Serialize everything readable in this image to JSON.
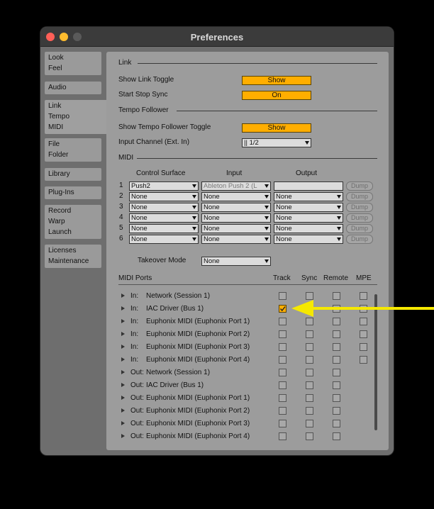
{
  "window": {
    "title": "Preferences"
  },
  "sidebar": {
    "tabs": [
      {
        "lines": [
          "Look",
          "Feel"
        ]
      },
      {
        "lines": [
          "Audio"
        ]
      },
      {
        "lines": [
          "Link",
          "Tempo",
          "MIDI"
        ]
      },
      {
        "lines": [
          "File",
          "Folder"
        ]
      },
      {
        "lines": [
          "Library"
        ]
      },
      {
        "lines": [
          "Plug-Ins"
        ]
      },
      {
        "lines": [
          "Record",
          "Warp",
          "Launch"
        ]
      },
      {
        "lines": [
          "Licenses",
          "Maintenance"
        ]
      }
    ]
  },
  "link": {
    "heading": "Link",
    "show_link_toggle_label": "Show Link Toggle",
    "show_link_toggle_value": "Show",
    "start_stop_sync_label": "Start Stop Sync",
    "start_stop_sync_value": "On"
  },
  "tempo": {
    "heading": "Tempo Follower",
    "show_toggle_label": "Show Tempo Follower Toggle",
    "show_toggle_value": "Show",
    "input_channel_label": "Input Channel (Ext. In)",
    "input_channel_value": "|| 1/2"
  },
  "midi": {
    "heading": "MIDI",
    "col_surface": "Control Surface",
    "col_input": "Input",
    "col_output": "Output",
    "rows": [
      {
        "num": "1",
        "surface": "Push2",
        "input": "Ableton Push 2 (L",
        "output": "",
        "dump": "Dump"
      },
      {
        "num": "2",
        "surface": "None",
        "input": "None",
        "output": "None",
        "dump": "Dump"
      },
      {
        "num": "3",
        "surface": "None",
        "input": "None",
        "output": "None",
        "dump": "Dump"
      },
      {
        "num": "4",
        "surface": "None",
        "input": "None",
        "output": "None",
        "dump": "Dump"
      },
      {
        "num": "5",
        "surface": "None",
        "input": "None",
        "output": "None",
        "dump": "Dump"
      },
      {
        "num": "6",
        "surface": "None",
        "input": "None",
        "output": "None",
        "dump": "Dump"
      }
    ],
    "takeover_label": "Takeover Mode",
    "takeover_value": "None"
  },
  "ports": {
    "heading": "MIDI Ports",
    "col_track": "Track",
    "col_sync": "Sync",
    "col_remote": "Remote",
    "col_mpe": "MPE",
    "rows": [
      {
        "dir": "In:",
        "name": "Network (Session 1)",
        "track": false,
        "mpe": true
      },
      {
        "dir": "In:",
        "name": "IAC Driver (Bus 1)",
        "track": true,
        "mpe": true
      },
      {
        "dir": "In:",
        "name": "Euphonix MIDI (Euphonix Port 1)",
        "track": false,
        "mpe": true
      },
      {
        "dir": "In:",
        "name": "Euphonix MIDI (Euphonix Port 2)",
        "track": false,
        "mpe": true
      },
      {
        "dir": "In:",
        "name": "Euphonix MIDI (Euphonix Port 3)",
        "track": false,
        "mpe": true
      },
      {
        "dir": "In:",
        "name": "Euphonix MIDI (Euphonix Port 4)",
        "track": false,
        "mpe": true
      },
      {
        "dir": "Out:",
        "name": "Network (Session 1)",
        "track": false,
        "mpe": false
      },
      {
        "dir": "Out:",
        "name": "IAC Driver (Bus 1)",
        "track": false,
        "mpe": false
      },
      {
        "dir": "Out:",
        "name": "Euphonix MIDI (Euphonix Port 1)",
        "track": false,
        "mpe": false
      },
      {
        "dir": "Out:",
        "name": "Euphonix MIDI (Euphonix Port 2)",
        "track": false,
        "mpe": false
      },
      {
        "dir": "Out:",
        "name": "Euphonix MIDI (Euphonix Port 3)",
        "track": false,
        "mpe": false
      },
      {
        "dir": "Out:",
        "name": "Euphonix MIDI (Euphonix Port 4)",
        "track": false,
        "mpe": false
      }
    ]
  },
  "colors": {
    "accent": "#ffae00",
    "annotation_arrow": "#f5e800",
    "close": "#ff5f57",
    "minimize": "#febc2e",
    "zoom": "#5a5a5a"
  }
}
